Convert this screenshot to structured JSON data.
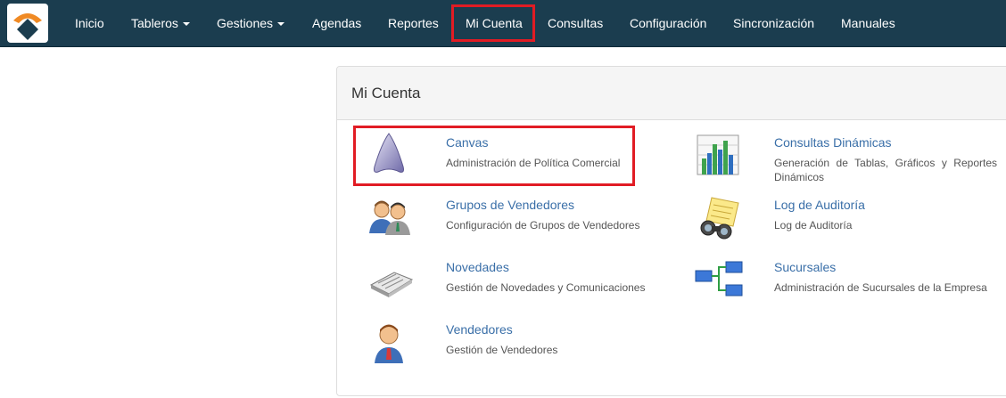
{
  "nav": {
    "items": [
      {
        "label": "Inicio",
        "dropdown": false
      },
      {
        "label": "Tableros",
        "dropdown": true
      },
      {
        "label": "Gestiones",
        "dropdown": true
      },
      {
        "label": "Agendas",
        "dropdown": false
      },
      {
        "label": "Reportes",
        "dropdown": false
      },
      {
        "label": "Mi Cuenta",
        "dropdown": false,
        "active": true
      },
      {
        "label": "Consultas",
        "dropdown": false
      },
      {
        "label": "Configuración",
        "dropdown": false
      },
      {
        "label": "Sincronización",
        "dropdown": false
      },
      {
        "label": "Manuales",
        "dropdown": false
      }
    ]
  },
  "panel": {
    "heading": "Mi Cuenta",
    "left": [
      {
        "icon": "canvas-icon",
        "title": "Canvas",
        "desc": "Administración de Política Comercial"
      },
      {
        "icon": "users-group-icon",
        "title": "Grupos de Vendedores",
        "desc": "Configuración de Grupos de Vendedores"
      },
      {
        "icon": "newspaper-icon",
        "title": "Novedades",
        "desc": "Gestión de Novedades y Comunicaciones"
      },
      {
        "icon": "user-icon",
        "title": "Vendedores",
        "desc": "Gestión de Vendedores"
      }
    ],
    "right": [
      {
        "icon": "bar-chart-icon",
        "title": "Consultas Dinámicas",
        "desc": "Generación de Tablas, Gráficos y Reportes Dinámicos"
      },
      {
        "icon": "binoculars-icon",
        "title": "Log de Auditoría",
        "desc": "Log de Auditoría"
      },
      {
        "icon": "branches-icon",
        "title": "Sucursales",
        "desc": "Administración de Sucursales de la Empresa"
      }
    ]
  },
  "colors": {
    "navbar": "#1b3d4f",
    "link": "#3a6fa8",
    "highlight": "#e11c24"
  }
}
